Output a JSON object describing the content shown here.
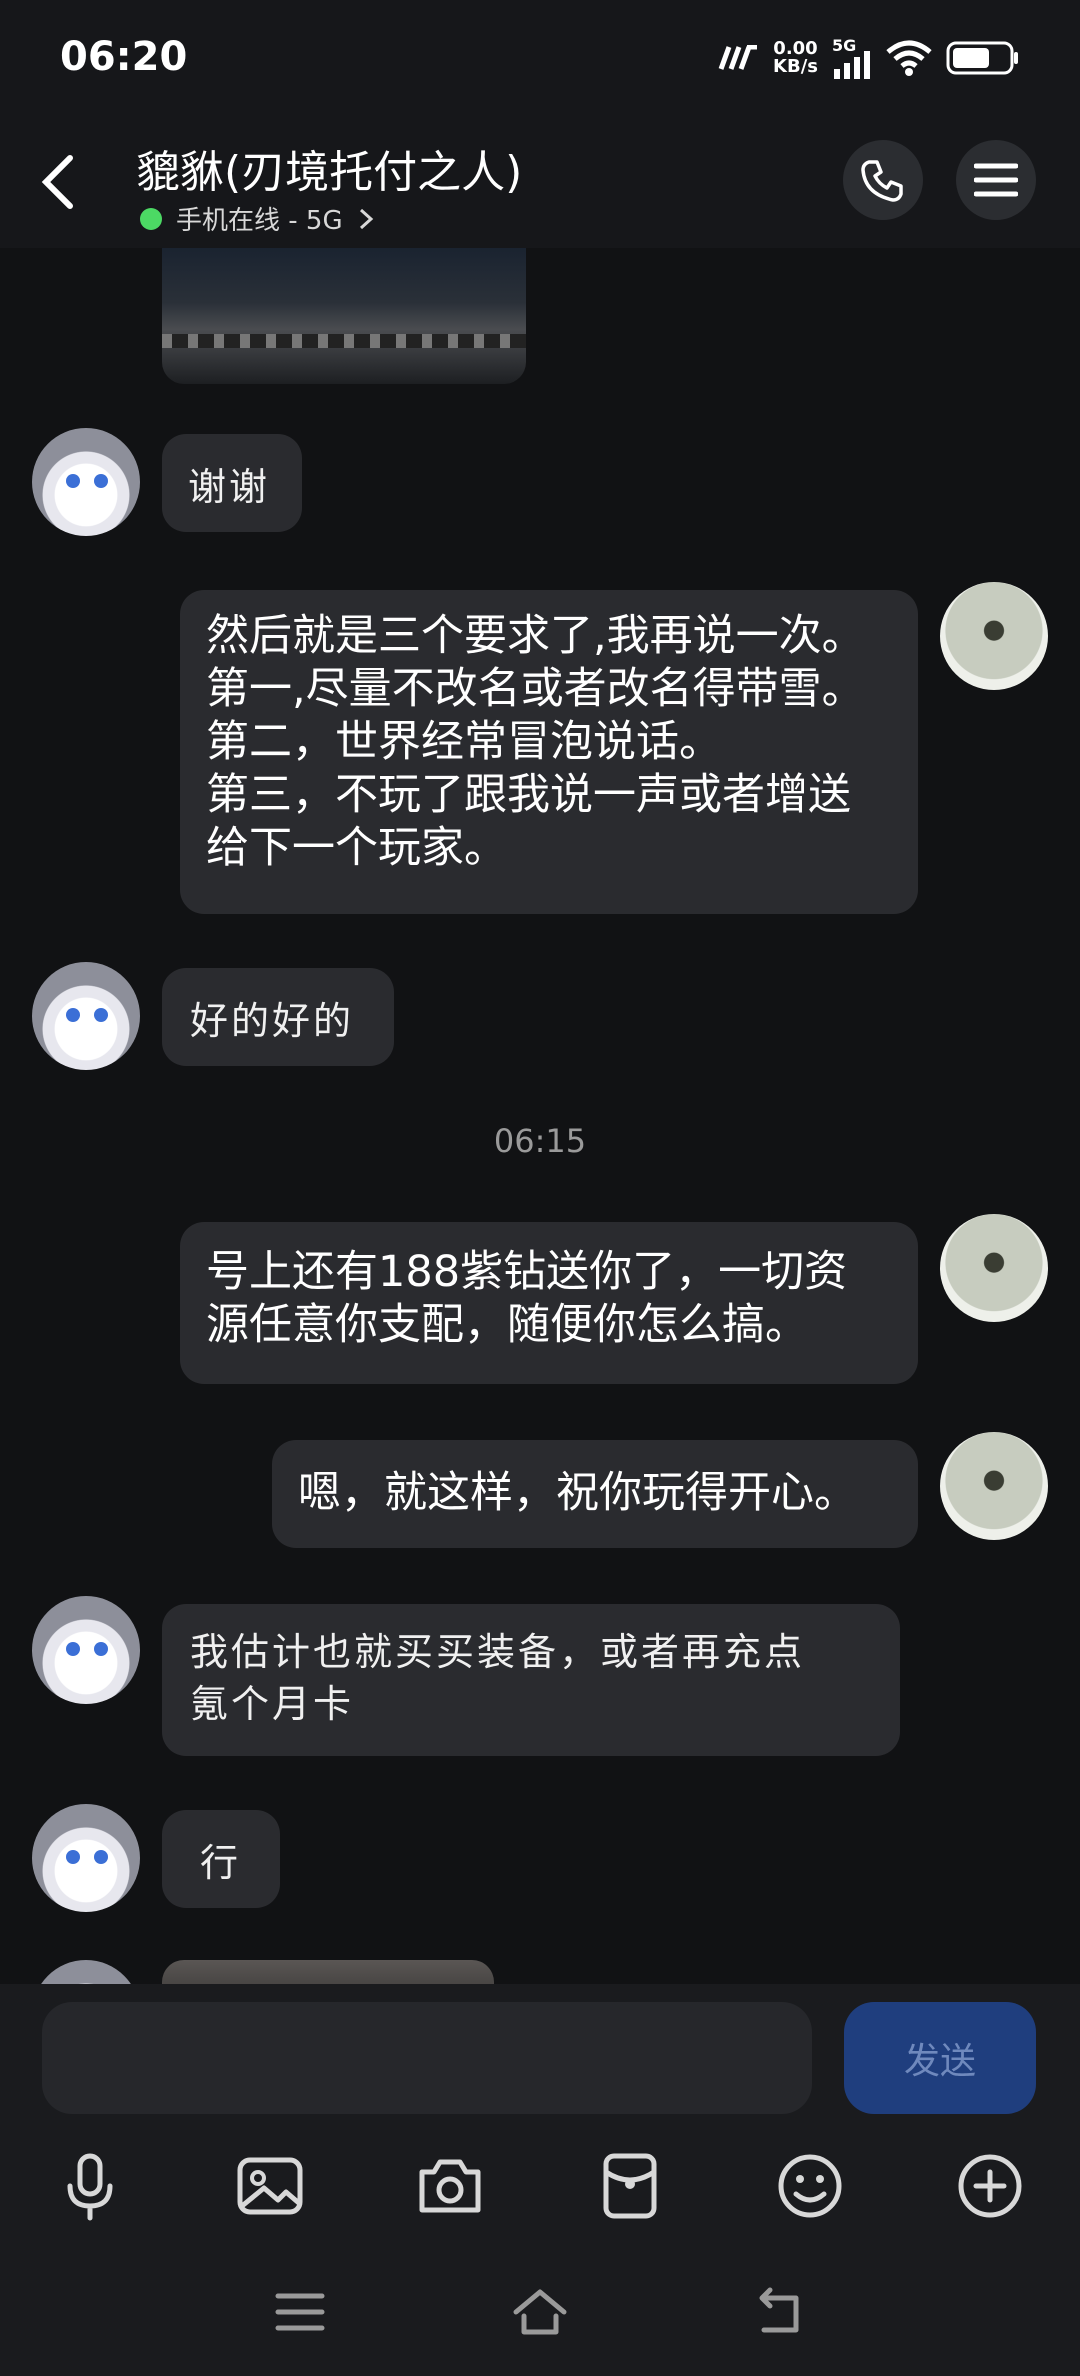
{
  "status": {
    "time": "06:20",
    "net_speed_value": "0.00",
    "net_speed_unit": "KB/s",
    "signal_label": "5G"
  },
  "header": {
    "contact_name": "貔貅(刃境托付之人)",
    "online_status": "手机在线 - 5G"
  },
  "messages": [
    {
      "from": "them",
      "text": "谢谢"
    },
    {
      "from": "me",
      "lines": [
        "然后就是三个要求了,我再说一次。",
        "第一,尽量不改名或者改名得带雪。",
        "第二，世界经常冒泡说话。",
        "第三，不玩了跟我说一声或者增送",
        "给下一个玩家。"
      ]
    },
    {
      "from": "them",
      "text": "好的好的"
    },
    {
      "from": "me",
      "lines": [
        "号上还有188紫钻送你了，一切资",
        "源任意你支配，随便你怎么搞。"
      ]
    },
    {
      "from": "me",
      "lines": [
        "嗯，就这样，祝你玩得开心。"
      ]
    },
    {
      "from": "them",
      "lines": [
        "我估计也就买买装备，或者再充点",
        "氪个月卡"
      ]
    },
    {
      "from": "them",
      "text": "行"
    }
  ],
  "timestamp": "06:15",
  "composer": {
    "send_label": "发送"
  },
  "icons": [
    "back-icon",
    "phone-icon",
    "menu-icon",
    "microphone-icon",
    "image-icon",
    "camera-icon",
    "red-packet-icon",
    "emoji-icon",
    "plus-icon",
    "nav-menu-icon",
    "nav-home-icon",
    "nav-back-icon",
    "wifi-icon",
    "battery-icon",
    "signal-icon"
  ],
  "colors": {
    "background": "#111214",
    "bubble": "#2a2b2f",
    "online": "#4cd964",
    "send_button": "#1f3e7e"
  }
}
